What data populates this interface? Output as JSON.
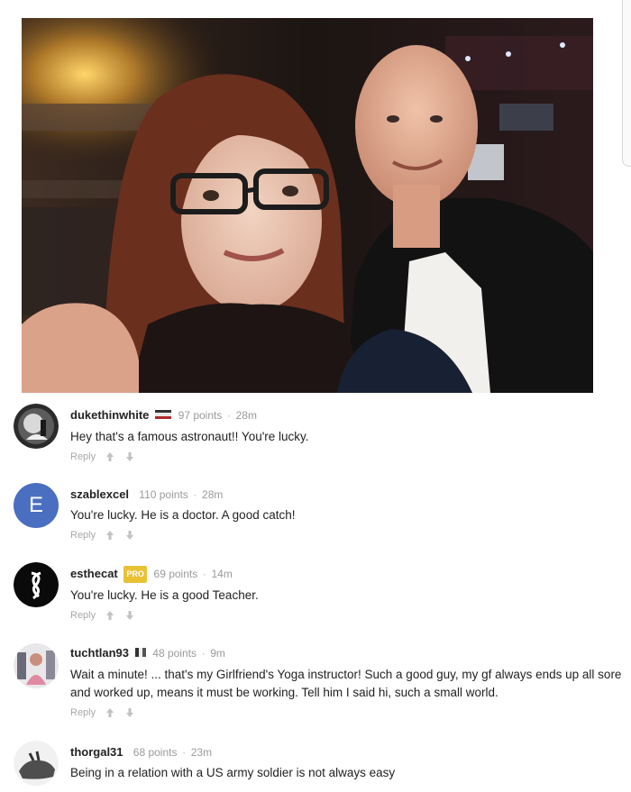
{
  "comments": [
    {
      "username": "dukethinwhite",
      "flag": "eu",
      "points": "97 points",
      "time": "28m",
      "text": "Hey that's a famous astronaut!! You're lucky.",
      "avatar_icon": "astronaut-avatar-icon"
    },
    {
      "username": "szablexcel",
      "points": "110 points",
      "time": "28m",
      "text": "You're lucky. He is a doctor. A good catch!",
      "avatar_letter": "E",
      "avatar_color": "#4a6fc1"
    },
    {
      "username": "esthecat",
      "badge": "PRO",
      "points": "69 points",
      "time": "14m",
      "text": "You're lucky. He is a good Teacher.",
      "avatar_icon": "swirl-logo-avatar-icon"
    },
    {
      "username": "tuchtlan93",
      "flag": "it",
      "points": "48 points",
      "time": "9m",
      "text": "Wait a minute! ... that's my Girlfriend's Yoga instructor! Such a good guy, my gf always ends up all sore and worked up, means it must be working. Tell him I said hi, such a small world.",
      "avatar_icon": "person-photo-avatar-icon"
    },
    {
      "username": "thorgal31",
      "points": "68 points",
      "time": "23m",
      "text": "Being in a relation with a US army soldier is not always easy",
      "avatar_icon": "animal-avatar-icon"
    }
  ],
  "labels": {
    "reply": "Reply",
    "separator": "·"
  },
  "colors": {
    "meta_gray": "#9a9a9a",
    "pro_badge": "#e9c234",
    "avatar_e": "#4a6fc1"
  }
}
